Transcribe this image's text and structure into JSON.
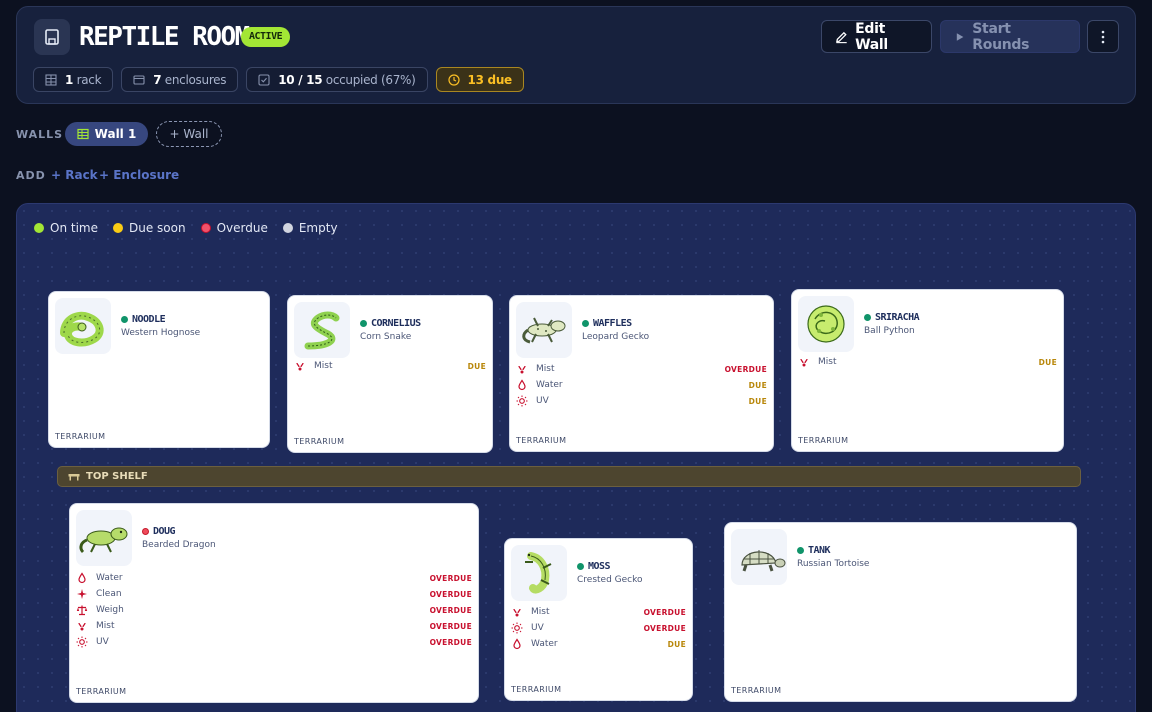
{
  "header": {
    "title": "REPTILE ROOM",
    "badge": "ACTIVE",
    "edit_label": "Edit Wall",
    "start_label": "Start Rounds",
    "stats": {
      "racks_count": "1",
      "racks_label": "rack",
      "enclosures_count": "7",
      "enclosures_label": "enclosures",
      "occupied_count": "10 / 15",
      "occupied_label": "occupied (67%)",
      "due_label": "13 due"
    }
  },
  "walls": {
    "label": "WALLS",
    "active_wall": "Wall 1",
    "add_wall": "+ Wall"
  },
  "add": {
    "label": "ADD",
    "rack": "+ Rack",
    "enclosure": "+ Enclosure"
  },
  "legend": {
    "on_time": "On time",
    "due_soon": "Due soon",
    "overdue": "Overdue",
    "empty": "Empty"
  },
  "colors": {
    "on_time": "#a3e635",
    "due_soon": "#facc15",
    "overdue": "#f0526a",
    "empty": "#d1d5e0"
  },
  "shelf": {
    "label": "TOP SHELF"
  },
  "enclosures": [
    {
      "name": "NOODLE",
      "species": "Western Hognose",
      "type": "TERRARIUM",
      "status": "on-time",
      "icon": "hognose-icon",
      "tasks": []
    },
    {
      "name": "CORNELIUS",
      "species": "Corn Snake",
      "type": "TERRARIUM",
      "status": "on-time",
      "icon": "corn-snake-icon",
      "tasks": [
        {
          "label": "Mist",
          "status": "DUE",
          "icon": "mist-icon"
        }
      ]
    },
    {
      "name": "WAFFLES",
      "species": "Leopard Gecko",
      "type": "TERRARIUM",
      "status": "on-time",
      "icon": "leopard-gecko-icon",
      "tasks": [
        {
          "label": "Mist",
          "status": "OVERDUE",
          "icon": "mist-icon"
        },
        {
          "label": "Water",
          "status": "DUE",
          "icon": "water-icon"
        },
        {
          "label": "UV",
          "status": "DUE",
          "icon": "uv-icon"
        }
      ]
    },
    {
      "name": "SRIRACHA",
      "species": "Ball Python",
      "type": "TERRARIUM",
      "status": "on-time",
      "icon": "ball-python-icon",
      "tasks": [
        {
          "label": "Mist",
          "status": "DUE",
          "icon": "mist-icon"
        }
      ]
    },
    {
      "name": "DOUG",
      "species": "Bearded Dragon",
      "type": "TERRARIUM",
      "status": "overdue",
      "icon": "bearded-dragon-icon",
      "tasks": [
        {
          "label": "Water",
          "status": "OVERDUE",
          "icon": "water-icon"
        },
        {
          "label": "Clean",
          "status": "OVERDUE",
          "icon": "clean-icon"
        },
        {
          "label": "Weigh",
          "status": "OVERDUE",
          "icon": "weigh-icon"
        },
        {
          "label": "Mist",
          "status": "OVERDUE",
          "icon": "mist-icon"
        },
        {
          "label": "UV",
          "status": "OVERDUE",
          "icon": "uv-icon"
        }
      ]
    },
    {
      "name": "MOSS",
      "species": "Crested Gecko",
      "type": "TERRARIUM",
      "status": "on-time",
      "icon": "crested-gecko-icon",
      "tasks": [
        {
          "label": "Mist",
          "status": "OVERDUE",
          "icon": "mist-icon"
        },
        {
          "label": "UV",
          "status": "OVERDUE",
          "icon": "uv-icon"
        },
        {
          "label": "Water",
          "status": "DUE",
          "icon": "water-icon"
        }
      ]
    },
    {
      "name": "TANK",
      "species": "Russian Tortoise",
      "type": "TERRARIUM",
      "status": "on-time",
      "icon": "tortoise-icon",
      "tasks": []
    }
  ]
}
